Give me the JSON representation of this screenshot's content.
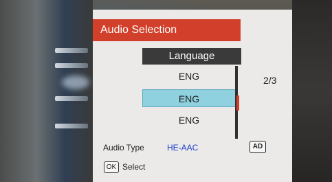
{
  "osd": {
    "title": "Audio Selection",
    "column_header": "Language",
    "items": [
      {
        "label": "ENG",
        "selected": false
      },
      {
        "label": "ENG",
        "selected": true
      },
      {
        "label": "ENG",
        "selected": false
      }
    ],
    "page_indicator": "2/3",
    "audio_type_label": "Audio Type",
    "audio_type_value": "HE-AAC",
    "ad_badge": "AD",
    "ok_key": "OK",
    "ok_action": "Select"
  },
  "colors": {
    "title_bar": "#d2402b",
    "selected_row": "#8fd1df",
    "audio_value": "#1a3cc8"
  }
}
